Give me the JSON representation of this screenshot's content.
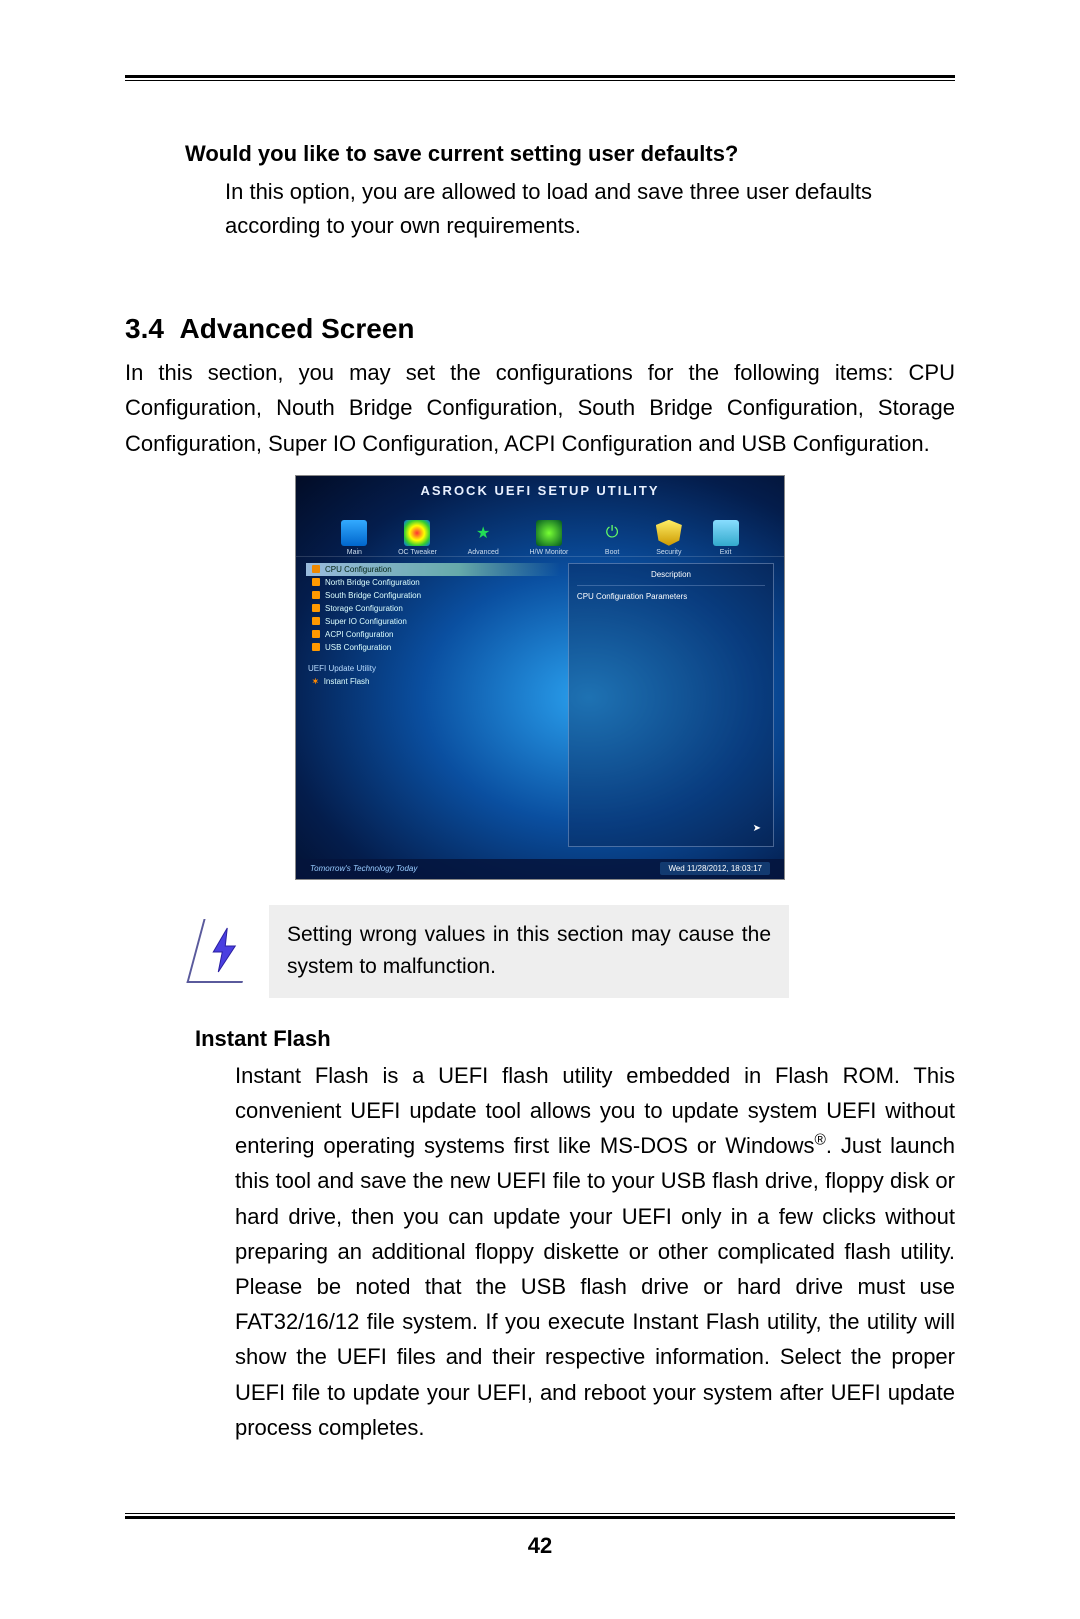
{
  "question": {
    "title": "Would you like to save current setting user defaults?",
    "body": "In this option, you are allowed to load and save three user defaults according to your own requirements."
  },
  "section": {
    "number": "3.4",
    "title": "Advanced Screen",
    "body": "In this section, you may set the configurations for the following items: CPU Configuration, Nouth Bridge Configuration, South Bridge Configuration, Storage Configuration, Super IO Configuration, ACPI Configuration and USB Configuration."
  },
  "bios": {
    "title": "ASROCK UEFI SETUP UTILITY",
    "tabs": [
      "Main",
      "OC Tweaker",
      "Advanced",
      "H/W Monitor",
      "Boot",
      "Security",
      "Exit"
    ],
    "menu": [
      "CPU Configuration",
      "North Bridge Configuration",
      "South Bridge Configuration",
      "Storage Configuration",
      "Super IO Configuration",
      "ACPI Configuration",
      "USB Configuration"
    ],
    "update_section": "UEFI Update Utility",
    "instant_flash": "Instant Flash",
    "desc_label": "Description",
    "desc_text": "CPU Configuration Parameters",
    "footer_slogan": "Tomorrow's Technology Today",
    "footer_ts": "Wed 11/28/2012, 18:03:17"
  },
  "note": {
    "text": "Setting wrong values in this section may cause the system to malfunction."
  },
  "instant_flash": {
    "title": "Instant Flash",
    "body_pre": "Instant Flash is a UEFI flash utility embedded in Flash ROM. This convenient UEFI update tool allows you to update system UEFI without entering operating systems first like MS-DOS or Windows",
    "body_post": ". Just launch this tool and save the new UEFI file to your USB flash drive, floppy disk or hard drive, then you can update your UEFI only in a few clicks without preparing an additional floppy diskette or other complicated flash utility. Please be noted that the USB flash drive or hard drive must use FAT32/16/12 file system. If you execute Instant Flash utility, the utility will show the UEFI files and their respective information. Select the proper UEFI file to update your UEFI, and reboot your system after UEFI update process completes."
  },
  "page_number": "42"
}
